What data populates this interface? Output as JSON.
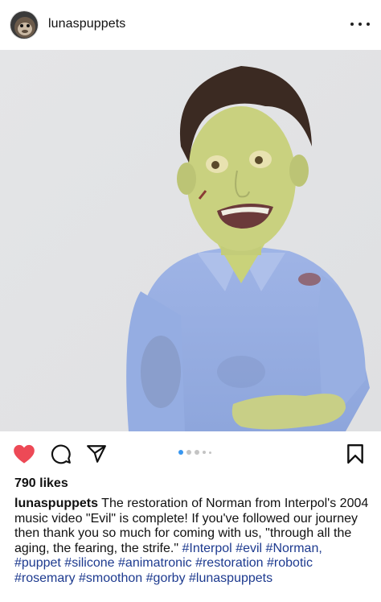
{
  "post": {
    "username": "lunaspuppets",
    "likes": "790 likes",
    "caption_author": "lunaspuppets",
    "caption_text": " The restoration of Norman from Interpol's 2004 music video \"Evil\" is complete! If you've followed our journey then thank you so much for coming with us, \"through all the aging, the fearing, the strife.\" ",
    "hashtags": [
      "#Interpol",
      "#evil",
      "#Norman,",
      "#puppet",
      "#silicone",
      "#animatronic",
      "#restoration",
      "#robotic",
      "#rosemary",
      "#smoothon",
      "#gorby",
      "#lunaspuppets"
    ],
    "carousel": {
      "count": 5,
      "active_index": 0
    }
  },
  "icons": {
    "avatar": "monkey-avatar",
    "more": "more-options-icon",
    "like": "heart-icon",
    "comment": "comment-icon",
    "share": "send-icon",
    "save": "bookmark-icon"
  },
  "colors": {
    "like": "#ed4956",
    "hashtag": "#1d3a8f",
    "carousel_active": "#3897f0"
  }
}
